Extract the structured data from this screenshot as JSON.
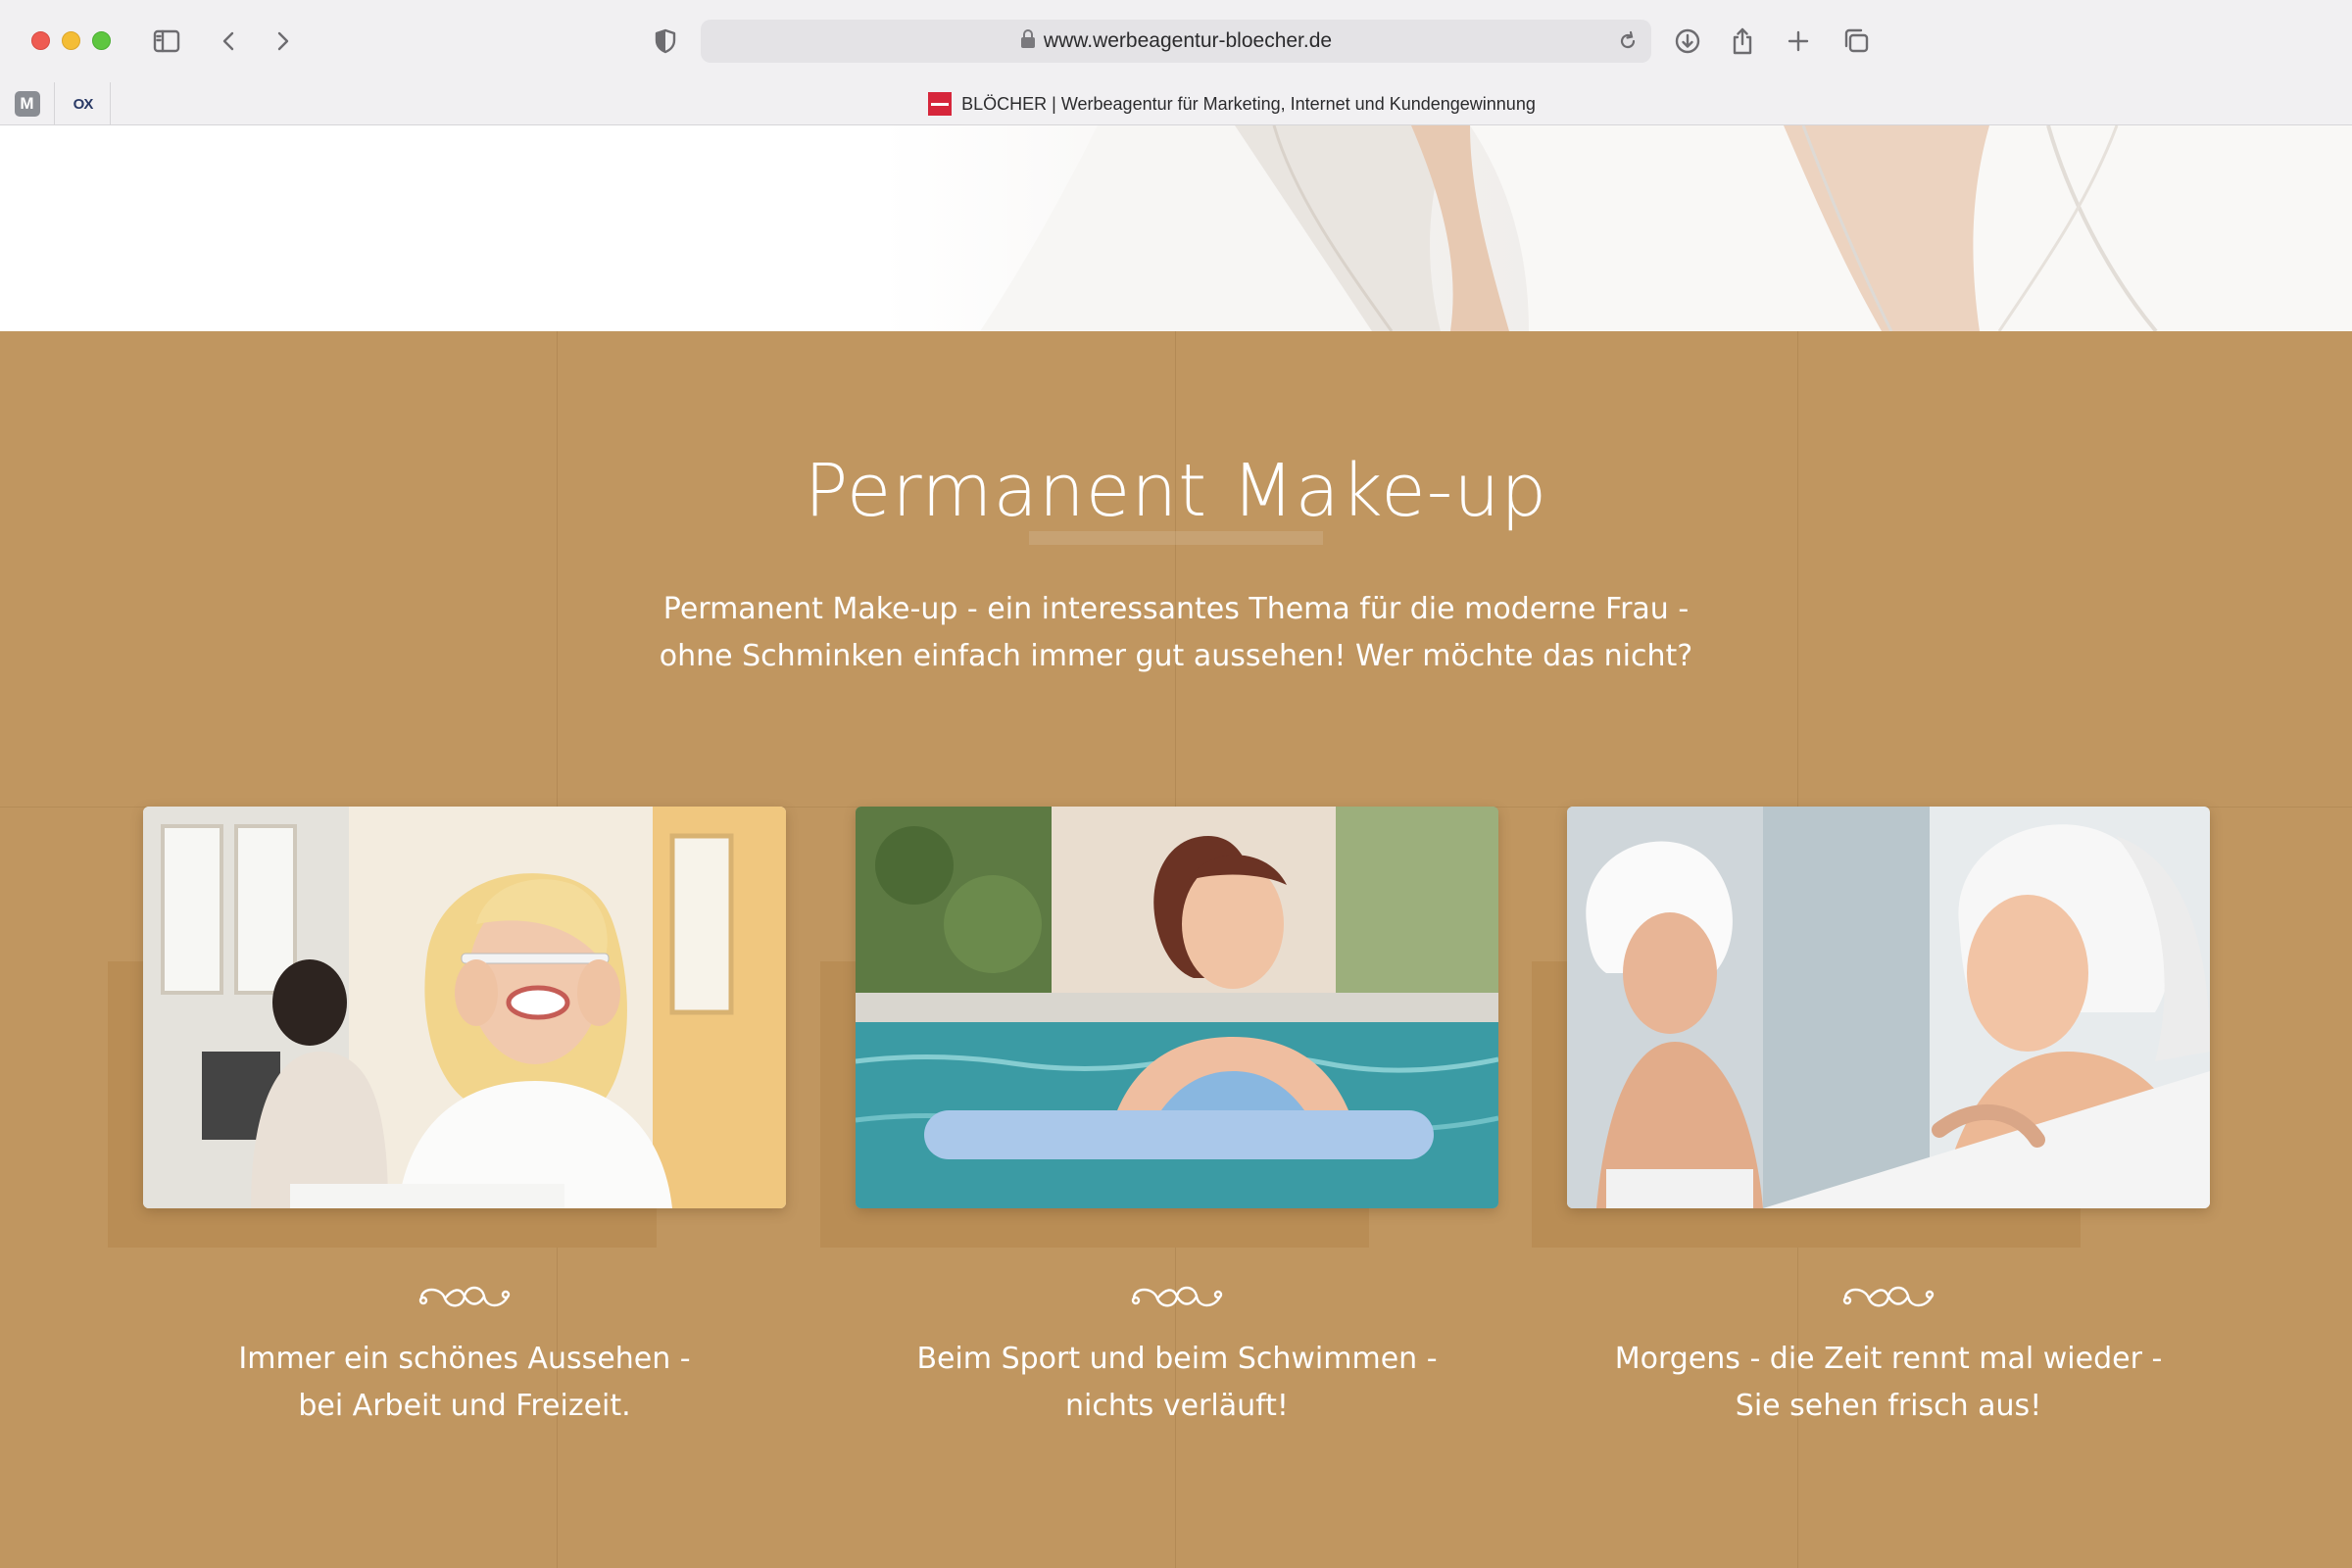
{
  "browser": {
    "url": "www.werbeagentur-bloecher.de",
    "tab_title": "BLÖCHER | Werbeagentur für Marketing, Internet und Kundengewinnung",
    "pinned_tabs": [
      {
        "label": "M"
      },
      {
        "label": "OX"
      }
    ]
  },
  "section": {
    "title": "Permanent Make-up",
    "intro_line1": "Permanent Make-up - ein interessantes Thema für die moderne Frau -",
    "intro_line2": "ohne Schminken einfach immer gut aussehen! Wer möchte das nicht?"
  },
  "cards": [
    {
      "caption_line1": "Immer ein schönes Aussehen -",
      "caption_line2": "bei Arbeit und Freizeit."
    },
    {
      "caption_line1": "Beim Sport und beim Schwimmen -",
      "caption_line2": "nichts verläuft!"
    },
    {
      "caption_line1": "Morgens - die Zeit rennt mal wieder -",
      "caption_line2": "Sie sehen frisch aus!"
    }
  ],
  "colors": {
    "section_background": "#c09660",
    "brand_favicon": "#d6263b"
  }
}
